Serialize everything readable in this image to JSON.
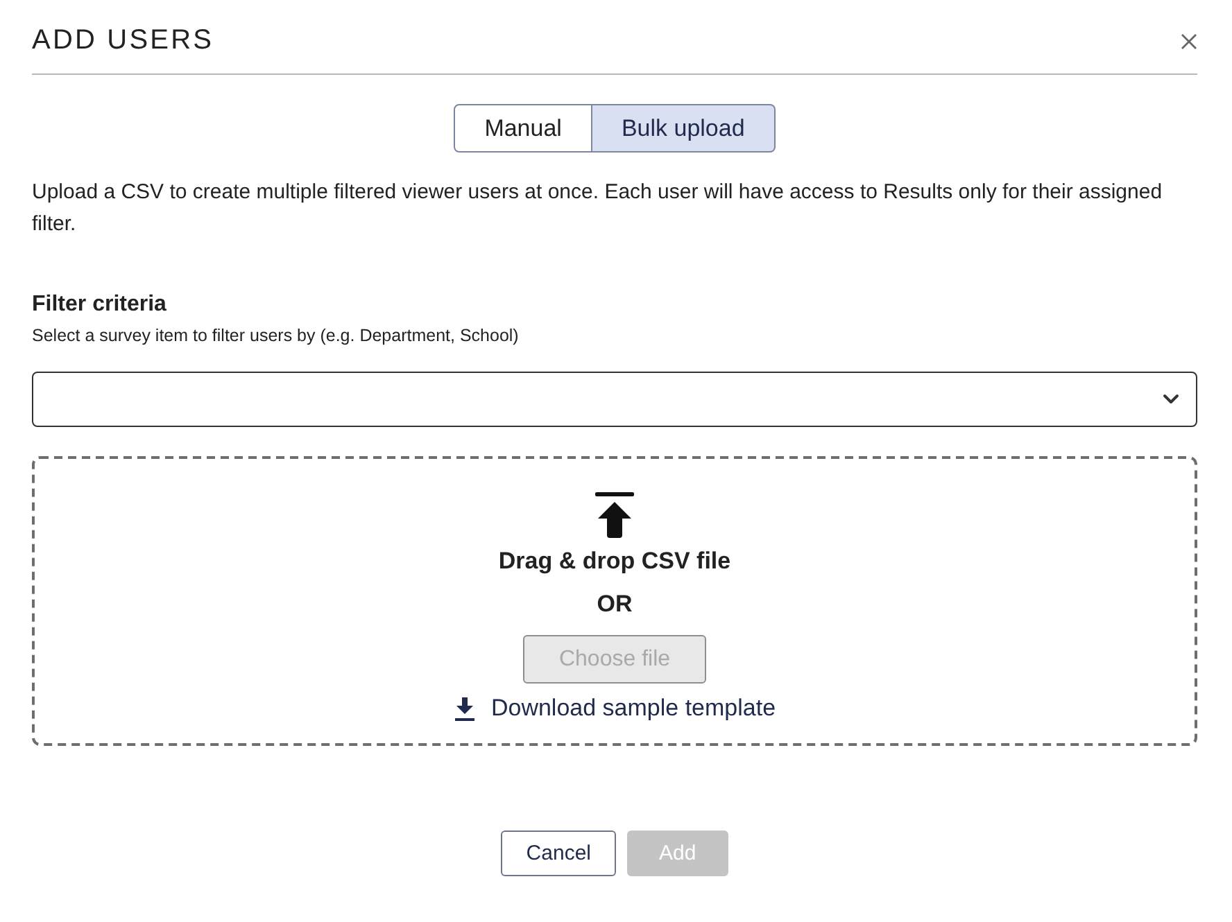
{
  "dialog": {
    "title": "ADD USERS"
  },
  "tabs": [
    {
      "label": "Manual",
      "selected": false
    },
    {
      "label": "Bulk upload",
      "selected": true
    }
  ],
  "description": "Upload a CSV to create multiple filtered viewer users at once. Each user will have access to Results only for their assigned filter.",
  "filter": {
    "label": "Filter criteria",
    "hint": "Select a survey item to filter users by (e.g. Department, School)"
  },
  "dropzone": {
    "prompt": "Drag & drop CSV file",
    "separator": "OR",
    "choose_button": {
      "label": "Choose file",
      "disabled": true
    },
    "download_link": "Download sample template"
  },
  "buttons": [
    {
      "label": "Cancel",
      "kind": "secondary",
      "disabled": false
    },
    {
      "label": "Add",
      "kind": "primary",
      "disabled": true
    }
  ]
}
